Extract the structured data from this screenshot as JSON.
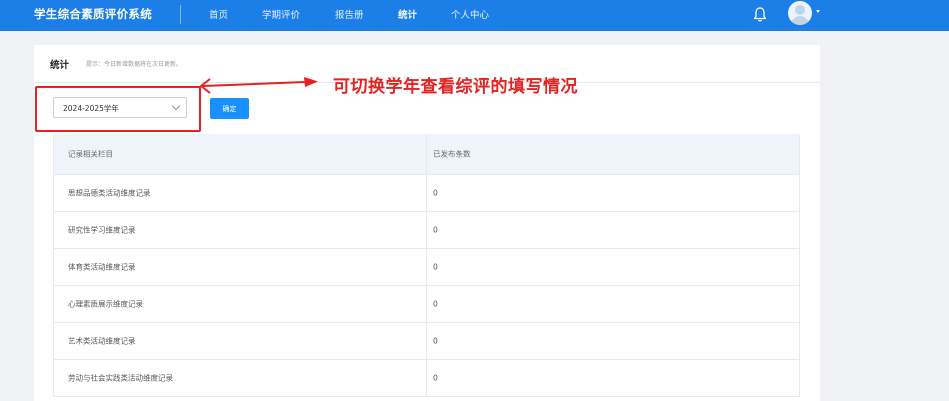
{
  "header": {
    "brand": "学生综合素质评价系统",
    "nav": [
      "首页",
      "学期评价",
      "报告册",
      "统计",
      "个人中心"
    ],
    "active_nav": "统计"
  },
  "card": {
    "title": "统计",
    "hint": "提示：今日新增数据将在次日更新。"
  },
  "filter": {
    "year_value": "2024-2025学年",
    "confirm_label": "确定"
  },
  "table": {
    "headers": [
      "记录相关栏目",
      "已发布条数"
    ],
    "rows": [
      [
        "思想品德类活动维度记录",
        "0"
      ],
      [
        "研究性学习维度记录",
        "0"
      ],
      [
        "体育类活动维度记录",
        "0"
      ],
      [
        "心理素质展示维度记录",
        "0"
      ],
      [
        "艺术类活动维度记录",
        "0"
      ],
      [
        "劳动与社会实践类活动维度记录",
        "0"
      ]
    ]
  },
  "annotation": {
    "text": "可切换学年查看综评的填写情况",
    "color": "#e32222"
  },
  "colors": {
    "header_bg": "#1c7fe8",
    "button_bg": "#1890ff"
  }
}
